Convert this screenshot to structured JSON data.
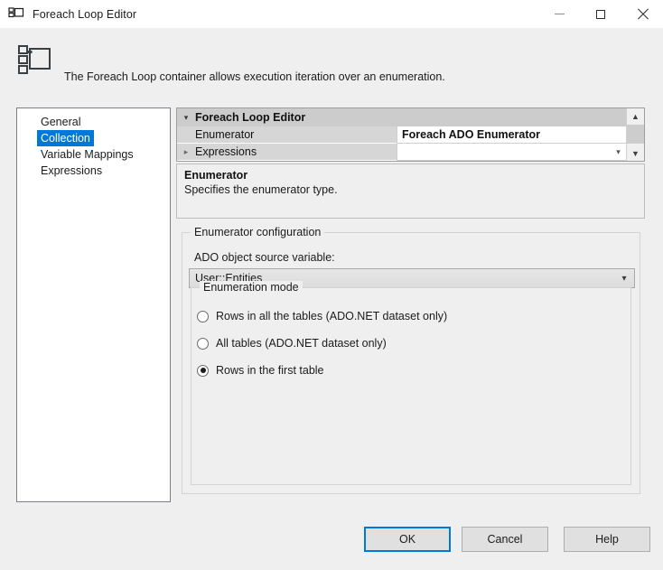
{
  "window": {
    "title": "Foreach Loop Editor",
    "icon": "foreach-loop-icon",
    "controls": {
      "minimize": "minimize-icon",
      "maximize": "maximize-icon",
      "close": "close-icon"
    }
  },
  "banner": {
    "icon": "foreach-loop-large-icon",
    "text": "The Foreach Loop container allows execution iteration over an enumeration."
  },
  "sidebar": {
    "items": [
      {
        "label": "General",
        "selected": false
      },
      {
        "label": "Collection",
        "selected": true
      },
      {
        "label": "Variable Mappings",
        "selected": false
      },
      {
        "label": "Expressions",
        "selected": false
      }
    ]
  },
  "property_grid": {
    "header": "Foreach Loop Editor",
    "header_chevron": "chevron-down-icon",
    "rows": [
      {
        "name": "Enumerator",
        "value": "Foreach ADO Enumerator",
        "expander": "",
        "bold_value": true,
        "has_dropdown": false
      },
      {
        "name": "Expressions",
        "value": "",
        "expander": "chevron-right-icon",
        "bold_value": false,
        "has_dropdown": true
      }
    ],
    "scrollbar": {
      "up": "scroll-up-arrow",
      "down": "scroll-down-arrow"
    }
  },
  "description": {
    "title": "Enumerator",
    "body": "Specifies the enumerator type."
  },
  "enumerator_configuration": {
    "legend": "Enumerator configuration",
    "ado_variable_label": "ADO object source variable:",
    "ado_variable_value": "User::Entities",
    "ado_variable_arrow": "chevron-down-icon",
    "enumeration_mode": {
      "legend": "Enumeration mode",
      "options": [
        {
          "label": "Rows in all the tables (ADO.NET dataset only)",
          "checked": false
        },
        {
          "label": "All tables (ADO.NET dataset only)",
          "checked": false
        },
        {
          "label": "Rows in the first table",
          "checked": true
        }
      ]
    }
  },
  "footer": {
    "ok": "OK",
    "cancel": "Cancel",
    "help": "Help"
  },
  "colors": {
    "accent": "#0078d7",
    "dialog_background": "#efefef",
    "titlebar_background": "#ffffff",
    "grid_row_background": "#cccccc",
    "button_face": "#e0e0e0"
  }
}
